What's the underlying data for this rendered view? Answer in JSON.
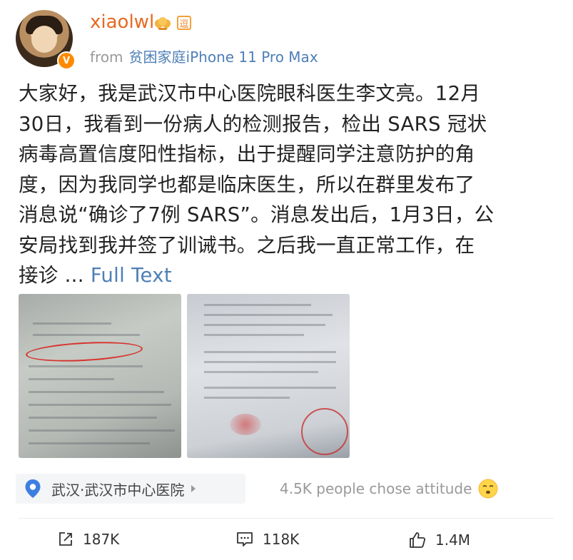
{
  "user": {
    "name": "xiaolwl",
    "level_badge": "逗",
    "source_prefix": "from",
    "device": "贫困家庭iPhone 11 Pro Max"
  },
  "post": {
    "lines": [
      "大家好，我是武汉市中心医院眼科医生李文亮。12月",
      "30日，我看到一份病人的检测报告，检出 SARS 冠状",
      "病毒高置信度阳性指标，出于提醒同学注意防护的角",
      "度，因为我同学也都是临床医生，所以在群里发布了",
      "消息说“确诊了7例 SARS”。消息发出后，1月3日，公",
      "安局找到我并签了训诫书。之后我一直正常工作，在"
    ],
    "last_line": "接诊 ...",
    "full_text_label": "Full Text"
  },
  "location": {
    "text": "武汉·武汉市中心医院"
  },
  "attitude": {
    "text": "4.5K people chose attitude",
    "emoji": "sleepy-face-icon"
  },
  "actions": {
    "repost": "187K",
    "comment": "118K",
    "like": "1.4M"
  },
  "colors": {
    "username": "#e86a23",
    "link": "#4f7fb6",
    "muted": "#9a9a9a",
    "verify_badge": "#ff8a00"
  }
}
